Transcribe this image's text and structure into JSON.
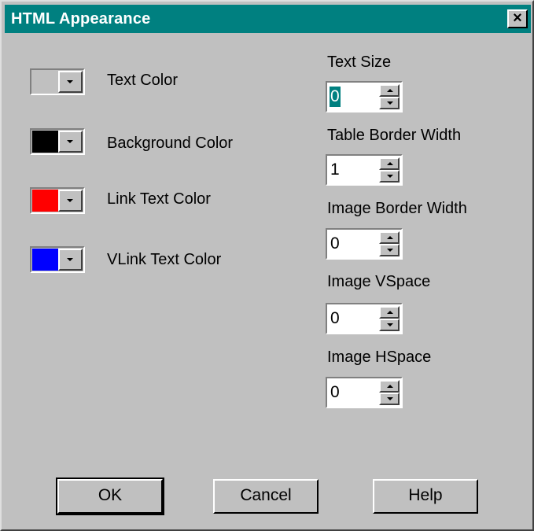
{
  "window": {
    "title": "HTML Appearance",
    "close_icon": "×"
  },
  "colors": [
    {
      "label": "Text Color",
      "swatch": "#c0c0c0"
    },
    {
      "label": "Background Color",
      "swatch": "#000000"
    },
    {
      "label": "Link Text Color",
      "swatch": "#ff0000"
    },
    {
      "label": "VLink Text Color",
      "swatch": "#0000ff"
    }
  ],
  "fields": [
    {
      "label": "Text Size",
      "value": "0",
      "selected": true
    },
    {
      "label": "Table Border Width",
      "value": "1"
    },
    {
      "label": "Image Border Width",
      "value": "0"
    },
    {
      "label": "Image VSpace",
      "value": "0"
    },
    {
      "label": "Image HSpace",
      "value": "0"
    }
  ],
  "buttons": {
    "ok": "OK",
    "cancel": "Cancel",
    "help": "Help"
  },
  "theme": {
    "title_bar": "#008080",
    "face": "#c0c0c0",
    "selection": "#008080"
  }
}
